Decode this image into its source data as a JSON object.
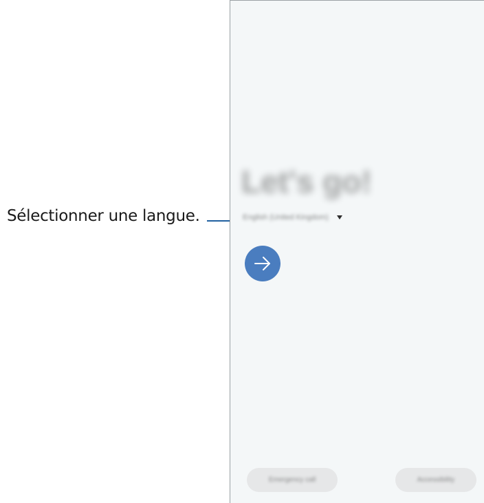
{
  "callout": {
    "text": "Sélectionner une langue.",
    "line_color": "#1f5fa0"
  },
  "screen": {
    "welcome_title": "Let's go!",
    "language_selector": {
      "selected": "English (United Kingdom)",
      "icon": "caret-down-icon"
    },
    "next_button": {
      "icon": "arrow-right-icon",
      "color": "#4a7dbf"
    },
    "bottom_buttons": {
      "emergency_call": "Emergency call",
      "accessibility": "Accessibility"
    }
  }
}
